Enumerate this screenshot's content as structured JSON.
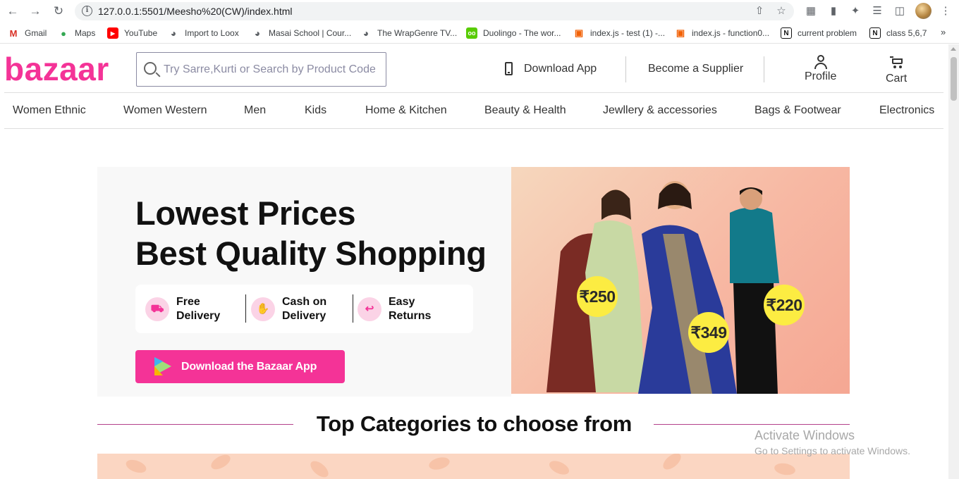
{
  "browser": {
    "url": "127.0.0.1:5501/Meesho%20(CW)/index.html",
    "bookmarks": [
      {
        "label": "Gmail",
        "icon": "gmail-icon"
      },
      {
        "label": "Maps",
        "icon": "maps-icon"
      },
      {
        "label": "YouTube",
        "icon": "youtube-icon"
      },
      {
        "label": "Import to Loox",
        "icon": "globe-icon"
      },
      {
        "label": "Masai School | Cour...",
        "icon": "globe-icon"
      },
      {
        "label": "The WrapGenre TV...",
        "icon": "globe-icon"
      },
      {
        "label": "Duolingo - The wor...",
        "icon": "duolingo-icon"
      },
      {
        "label": "index.js - test (1) -...",
        "icon": "replit-icon"
      },
      {
        "label": "index.js - function0...",
        "icon": "replit-icon"
      },
      {
        "label": "current problem",
        "icon": "notion-icon"
      },
      {
        "label": "class 5,6,7",
        "icon": "notion-icon"
      }
    ],
    "more": "»"
  },
  "header": {
    "logo": "bazaar",
    "search_placeholder": "Try Sarre,Kurti or Search by Product Code",
    "download_app": "Download App",
    "become_supplier": "Become a Supplier",
    "profile": "Profile",
    "cart": "Cart"
  },
  "categories": [
    "Women Ethnic",
    "Women Western",
    "Men",
    "Kids",
    "Home & Kitchen",
    "Beauty & Health",
    "Jewllery & accessories",
    "Bags & Footwear",
    "Electronics"
  ],
  "hero": {
    "title_line1": "Lowest Prices",
    "title_line2": "Best Quality Shopping",
    "features": [
      {
        "line1": "Free",
        "line2": "Delivery"
      },
      {
        "line1": "Cash on",
        "line2": "Delivery"
      },
      {
        "line1": "Easy",
        "line2": "Returns"
      }
    ],
    "app_button": "Download the Bazaar App",
    "prices": [
      "₹250",
      "₹349",
      "₹220"
    ]
  },
  "section": {
    "top_categories": "Top Categories to choose from"
  },
  "os_watermark": {
    "line1": "Activate Windows",
    "line2": "Go to Settings to activate Windows."
  },
  "colors": {
    "brand": "#f43397",
    "price_badge": "#fcec42"
  }
}
